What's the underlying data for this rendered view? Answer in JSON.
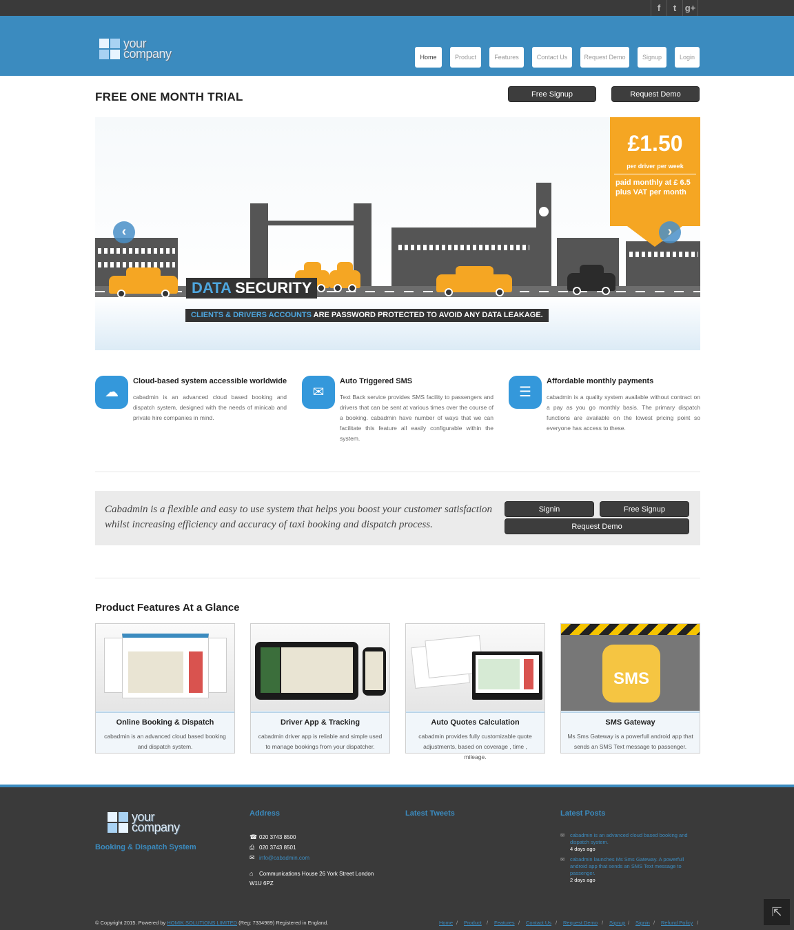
{
  "social": {
    "facebook": "f",
    "twitter": "t",
    "googleplus": "g+"
  },
  "header": {
    "logo_line1": "your",
    "logo_line2": "company",
    "nav": [
      "Home",
      "Product",
      "Features",
      "Contact Us",
      "Request Demo",
      "Signup",
      "Login"
    ]
  },
  "trial": {
    "title": "FREE ONE MONTH TRIAL",
    "free_signup": "Free Signup",
    "request_demo": "Request Demo"
  },
  "slider": {
    "price": "£1.50",
    "per_driver": "per driver per week",
    "monthly": "paid monthly at £ 6.5 plus VAT per month",
    "prev": "‹",
    "next": "›",
    "headline_blue": "DATA",
    "headline_white": "SECURITY",
    "caption_blue": "CLIENTS & DRIVERS ACCOUNTS",
    "caption_white": "ARE PASSWORD PROTECTED TO AVOID ANY DATA LEAKAGE."
  },
  "features": [
    {
      "icon": "cloud-icon",
      "glyph": "☁",
      "title": "Cloud-based system accessible worldwide",
      "text": "cabadmin is an advanced cloud based booking and dispatch system, designed with the needs of minicab and private hire companies in mind."
    },
    {
      "icon": "envelope-icon",
      "glyph": "✉",
      "title": "Auto Triggered SMS",
      "text": "Text Back service provides SMS facility to passengers and drivers that can be sent at various times over the course of a booking. cabadmin have number of ways that we can facilitate this feature all easily configurable within the system."
    },
    {
      "icon": "list-icon",
      "glyph": "☰",
      "title": "Affordable monthly payments",
      "text": "cabadmin is a quality system available without contract on a pay as you go monthly basis. The primary dispatch functions are available on the lowest pricing point so everyone has access to these."
    }
  ],
  "promo": {
    "text": "Cabadmin is a flexible and easy to use system that helps you boost your customer satisfaction whilst increasing efficiency and accuracy of taxi booking and dispatch process.",
    "signin": "Signin",
    "free_signup": "Free Signup",
    "request_demo": "Request Demo"
  },
  "products": {
    "title": "Product Features At a Glance",
    "cards": [
      {
        "title": "Online Booking & Dispatch",
        "text": "cabadmin is an advanced cloud based booking and dispatch system."
      },
      {
        "title": "Driver App & Tracking",
        "text": "cabadmin driver app is reliable and simple used to manage bookings from your dispatcher."
      },
      {
        "title": "Auto Quotes Calculation",
        "text": "cabadmin provides fully customizable quote adjustments, based on coverage , time , mileage."
      },
      {
        "title": "SMS Gateway",
        "text": "Ms Sms Gateway is a powerfull android app that sends an SMS Text message to passenger."
      }
    ],
    "sms_logo": "SMS"
  },
  "footer": {
    "logo_line1": "your",
    "logo_line2": "company",
    "tagline": "Booking & Dispatch System",
    "address_head": "Address",
    "phone1": "020 3743 8500",
    "phone2": "020 3743 8501",
    "email": "info@cabadmin.com",
    "address": "Communications House 26 York Street London",
    "postcode": "W1U 6PZ",
    "tweets_head": "Latest Tweets",
    "posts_head": "Latest Posts",
    "posts": [
      {
        "text": "cabadmin is an advanced cloud based booking and dispatch system.",
        "ago": "4 days ago"
      },
      {
        "text": "cabadmin launches Ms Sms Gateway. A powerfull android app that sends an SMS Text message to passenger.",
        "ago": "2 days ago"
      }
    ],
    "copyright_pre": "© Copyright 2015. Powered by",
    "copyright_link": "HOMIK SOLUTIONS LIMITED",
    "copyright_post": "(Reg: 7334989) Registered in England.",
    "links": [
      "Home",
      "Product",
      "Features",
      "Contact Us",
      "Request Demo",
      "Signup",
      "Signin",
      "Refund Policy"
    ],
    "to_top": "⇱"
  }
}
